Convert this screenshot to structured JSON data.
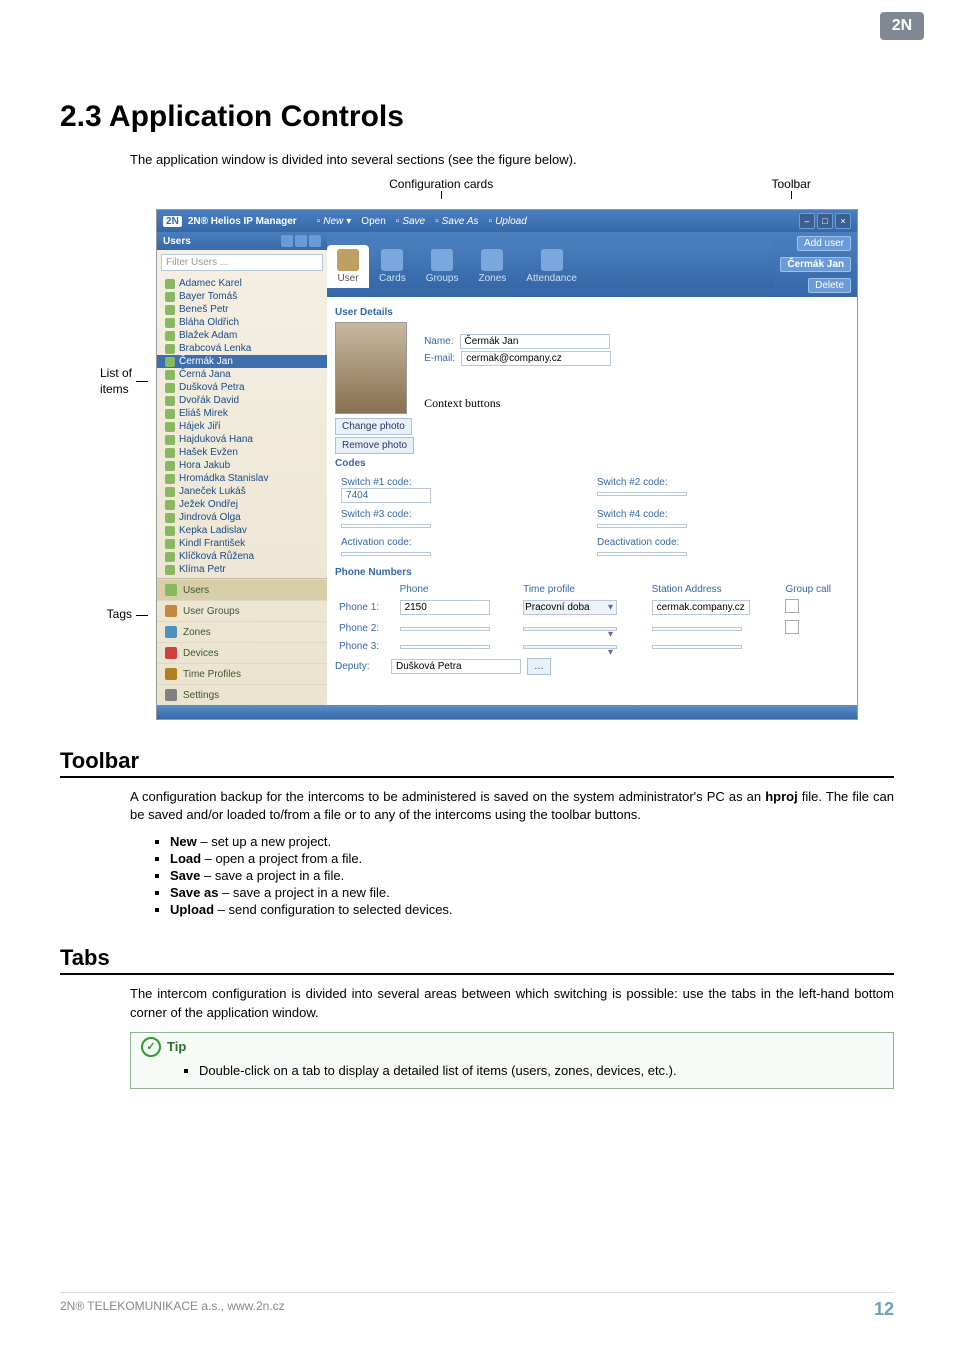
{
  "h1": "2.3 Application Controls",
  "intro": "The application window is divided into several sections (see the figure below).",
  "figlabels": {
    "cfg": "Configuration cards",
    "toolbar": "Toolbar",
    "list": "List of\nitems",
    "tags": "Tags",
    "context": "Context buttons"
  },
  "toolbar_section": {
    "h": "Toolbar",
    "p": "A configuration backup for the intercoms to be administered is saved on the system administrator's PC as an hproj file. The file can be saved and/or loaded to/from a file or to any of the intercoms using the toolbar buttons.",
    "items": [
      {
        "b": "New",
        "t": " – set up a new project."
      },
      {
        "b": "Load",
        "t": " – open a project from a file."
      },
      {
        "b": "Save",
        "t": " – save a project in a file."
      },
      {
        "b": "Save as",
        "t": " – save a project in a new file."
      },
      {
        "b": "Upload",
        "t": " – send configuration to selected devices."
      }
    ]
  },
  "tabs_section": {
    "h": "Tabs",
    "p": "The intercom configuration is divided into several areas between which switching is possible: use the tabs in the left-hand bottom corner of the application window.",
    "tip_h": "Tip",
    "tip": "Double-click on a tab to display a detailed list of items (users, zones, devices, etc.)."
  },
  "footer": {
    "l": "2N® TELEKOMUNIKACE a.s., www.2n.cz",
    "r": "12"
  },
  "app": {
    "logo": "2N",
    "title": "2N® Helios IP Manager",
    "toolbar": [
      "New",
      "Open",
      "Save",
      "Save As",
      "Upload"
    ],
    "wbtns": [
      "–",
      "□",
      "×"
    ],
    "side": {
      "head": "Users",
      "filter": "Filter Users ...",
      "users": [
        "Adamec Karel",
        "Bayer Tomáš",
        "Beneš Petr",
        "Bláha Oldřich",
        "Blažek Adam",
        "Brabcová Lenka",
        "Čermák Jan",
        "Černá Jana",
        "Dušková Petra",
        "Dvořák David",
        "Eliáš Mirek",
        "Hájek Jiří",
        "Hajduková Hana",
        "Hašek Evžen",
        "Hora Jakub",
        "Hromádka Stanislav",
        "Janeček Lukáš",
        "Ježek Ondřej",
        "Jindrová Olga",
        "Kepka Ladislav",
        "Kindl František",
        "Klíčková Růžena",
        "Klíma Petr"
      ],
      "sel": 6,
      "tags": [
        "Users",
        "User Groups",
        "Zones",
        "Devices",
        "Time Profiles",
        "Settings"
      ]
    },
    "tabs": [
      "User",
      "Cards",
      "Groups",
      "Zones",
      "Attendance"
    ],
    "tabsel": 0,
    "mainbtns": [
      "Add user",
      "Delete"
    ],
    "maintitle": "Čermák Jan",
    "details": {
      "h": "User Details",
      "name_l": "Name:",
      "name": "Čermák Jan",
      "email_l": "E-mail:",
      "email": "cermak@company.cz",
      "changephoto": "Change photo",
      "removephoto": "Remove photo"
    },
    "codes": {
      "h": "Codes",
      "c": [
        [
          "Switch #1 code:",
          "7404"
        ],
        [
          "Switch #2 code:",
          ""
        ],
        [
          "Switch #3 code:",
          ""
        ],
        [
          "Switch #4 code:",
          ""
        ],
        [
          "Activation code:",
          ""
        ],
        [
          "Deactivation code:",
          ""
        ]
      ]
    },
    "phones": {
      "h": "Phone Numbers",
      "cols": [
        "",
        "Phone",
        "Time profile",
        "Station Address",
        "Group call"
      ],
      "rows": [
        [
          "Phone 1:",
          "2150",
          "Pracovní doba",
          "cermak.company.cz",
          "☐"
        ],
        [
          "Phone 2:",
          "",
          "",
          "",
          "☐"
        ],
        [
          "Phone 3:",
          "",
          "",
          "",
          ""
        ]
      ],
      "deputy_l": "Deputy:",
      "deputy": "Dušková Petra"
    }
  }
}
